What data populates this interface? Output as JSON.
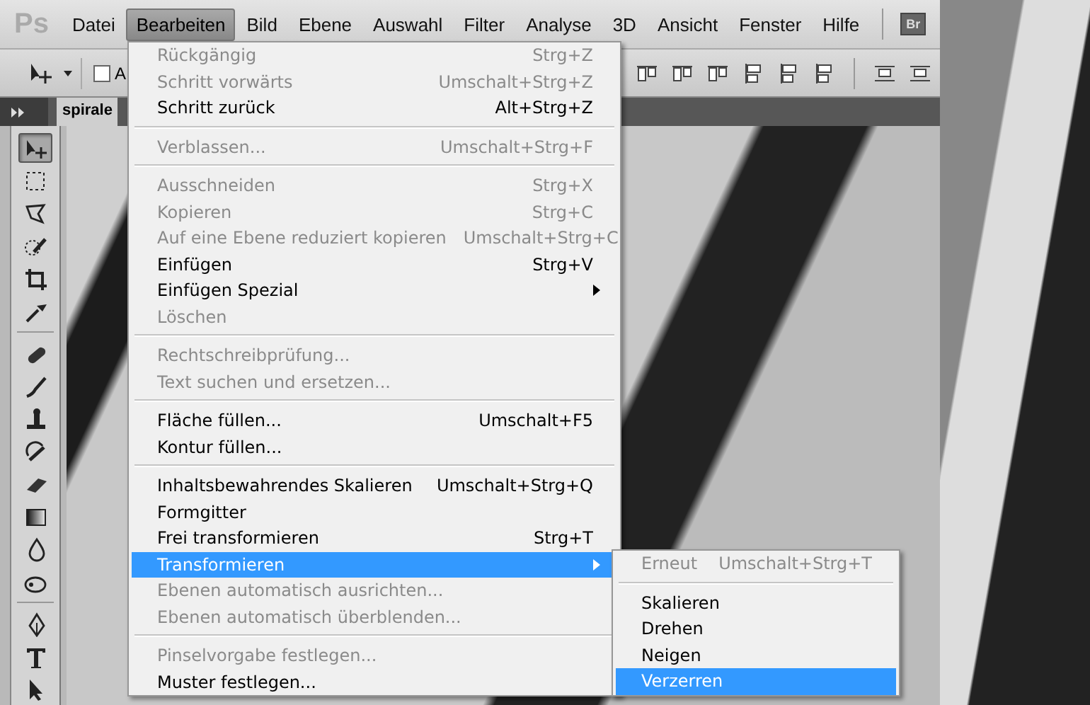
{
  "app": {
    "logo": "Ps",
    "bridge_button": "Br"
  },
  "menubar": [
    {
      "label": "Datei",
      "selected": false
    },
    {
      "label": "Bearbeiten",
      "selected": true
    },
    {
      "label": "Bild",
      "selected": false
    },
    {
      "label": "Ebene",
      "selected": false
    },
    {
      "label": "Auswahl",
      "selected": false
    },
    {
      "label": "Filter",
      "selected": false
    },
    {
      "label": "Analyse",
      "selected": false
    },
    {
      "label": "3D",
      "selected": false
    },
    {
      "label": "Ansicht",
      "selected": false
    },
    {
      "label": "Fenster",
      "selected": false
    },
    {
      "label": "Hilfe",
      "selected": false
    }
  ],
  "options_bar": {
    "checkbox": {
      "label": "A",
      "checked": false
    }
  },
  "document_tab": {
    "title": "spirale"
  },
  "tool_groups": [
    {
      "tools": [
        {
          "kind": "move",
          "selected": true
        },
        {
          "kind": "marquee",
          "selected": false
        },
        {
          "kind": "lasso",
          "selected": false
        },
        {
          "kind": "quick-select",
          "selected": false
        },
        {
          "kind": "crop",
          "selected": false
        },
        {
          "kind": "eyedropper",
          "selected": false
        }
      ]
    },
    {
      "tools": [
        {
          "kind": "healing",
          "selected": false
        },
        {
          "kind": "brush",
          "selected": false
        },
        {
          "kind": "stamp",
          "selected": false
        },
        {
          "kind": "history-brush",
          "selected": false
        },
        {
          "kind": "eraser",
          "selected": false
        },
        {
          "kind": "gradient",
          "selected": false
        },
        {
          "kind": "blur",
          "selected": false
        },
        {
          "kind": "dodge",
          "selected": false
        }
      ]
    },
    {
      "tools": [
        {
          "kind": "pen",
          "selected": false
        },
        {
          "kind": "type",
          "selected": false
        },
        {
          "kind": "path-select",
          "selected": false
        }
      ]
    }
  ],
  "edit_menu": [
    {
      "kind": "item",
      "label": "Rückgängig",
      "shortcut": "Strg+Z",
      "disabled": true,
      "submenu": false,
      "selected": false
    },
    {
      "kind": "item",
      "label": "Schritt vorwärts",
      "shortcut": "Umschalt+Strg+Z",
      "disabled": true,
      "submenu": false,
      "selected": false
    },
    {
      "kind": "item",
      "label": "Schritt zurück",
      "shortcut": "Alt+Strg+Z",
      "disabled": false,
      "submenu": false,
      "selected": false
    },
    {
      "kind": "separator"
    },
    {
      "kind": "item",
      "label": "Verblassen...",
      "shortcut": "Umschalt+Strg+F",
      "disabled": true,
      "submenu": false,
      "selected": false
    },
    {
      "kind": "separator"
    },
    {
      "kind": "item",
      "label": "Ausschneiden",
      "shortcut": "Strg+X",
      "disabled": true,
      "submenu": false,
      "selected": false
    },
    {
      "kind": "item",
      "label": "Kopieren",
      "shortcut": "Strg+C",
      "disabled": true,
      "submenu": false,
      "selected": false
    },
    {
      "kind": "item",
      "label": "Auf eine Ebene reduziert kopieren",
      "shortcut": "Umschalt+Strg+C",
      "disabled": true,
      "submenu": false,
      "selected": false
    },
    {
      "kind": "item",
      "label": "Einfügen",
      "shortcut": "Strg+V",
      "disabled": false,
      "submenu": false,
      "selected": false
    },
    {
      "kind": "item",
      "label": "Einfügen Spezial",
      "disabled": false,
      "submenu": true,
      "selected": false
    },
    {
      "kind": "item",
      "label": "Löschen",
      "disabled": true,
      "submenu": false,
      "selected": false
    },
    {
      "kind": "separator"
    },
    {
      "kind": "item",
      "label": "Rechtschreibprüfung...",
      "disabled": true,
      "submenu": false,
      "selected": false
    },
    {
      "kind": "item",
      "label": "Text suchen und ersetzen...",
      "disabled": true,
      "submenu": false,
      "selected": false
    },
    {
      "kind": "separator"
    },
    {
      "kind": "item",
      "label": "Fläche füllen...",
      "shortcut": "Umschalt+F5",
      "disabled": false,
      "submenu": false,
      "selected": false
    },
    {
      "kind": "item",
      "label": "Kontur füllen...",
      "disabled": false,
      "submenu": false,
      "selected": false
    },
    {
      "kind": "separator"
    },
    {
      "kind": "item",
      "label": "Inhaltsbewahrendes Skalieren",
      "shortcut": "Umschalt+Strg+Q",
      "disabled": false,
      "submenu": false,
      "selected": false
    },
    {
      "kind": "item",
      "label": "Formgitter",
      "disabled": false,
      "submenu": false,
      "selected": false
    },
    {
      "kind": "item",
      "label": "Frei transformieren",
      "shortcut": "Strg+T",
      "disabled": false,
      "submenu": false,
      "selected": false
    },
    {
      "kind": "item",
      "label": "Transformieren",
      "disabled": false,
      "submenu": true,
      "selected": true
    },
    {
      "kind": "item",
      "label": "Ebenen automatisch ausrichten...",
      "disabled": true,
      "submenu": false,
      "selected": false
    },
    {
      "kind": "item",
      "label": "Ebenen automatisch überblenden...",
      "disabled": true,
      "submenu": false,
      "selected": false
    },
    {
      "kind": "separator"
    },
    {
      "kind": "item",
      "label": "Pinselvorgabe festlegen...",
      "disabled": true,
      "submenu": false,
      "selected": false
    },
    {
      "kind": "item",
      "label": "Muster festlegen...",
      "disabled": false,
      "submenu": false,
      "selected": false
    }
  ],
  "transform_submenu": [
    {
      "kind": "item",
      "label": "Erneut",
      "shortcut": "Umschalt+Strg+T",
      "disabled": true,
      "submenu": false,
      "selected": false
    },
    {
      "kind": "separator"
    },
    {
      "kind": "item",
      "label": "Skalieren",
      "disabled": false,
      "submenu": false,
      "selected": false
    },
    {
      "kind": "item",
      "label": "Drehen",
      "disabled": false,
      "submenu": false,
      "selected": false
    },
    {
      "kind": "item",
      "label": "Neigen",
      "disabled": false,
      "submenu": false,
      "selected": false
    },
    {
      "kind": "item",
      "label": "Verzerren",
      "disabled": false,
      "submenu": false,
      "selected": true
    }
  ]
}
